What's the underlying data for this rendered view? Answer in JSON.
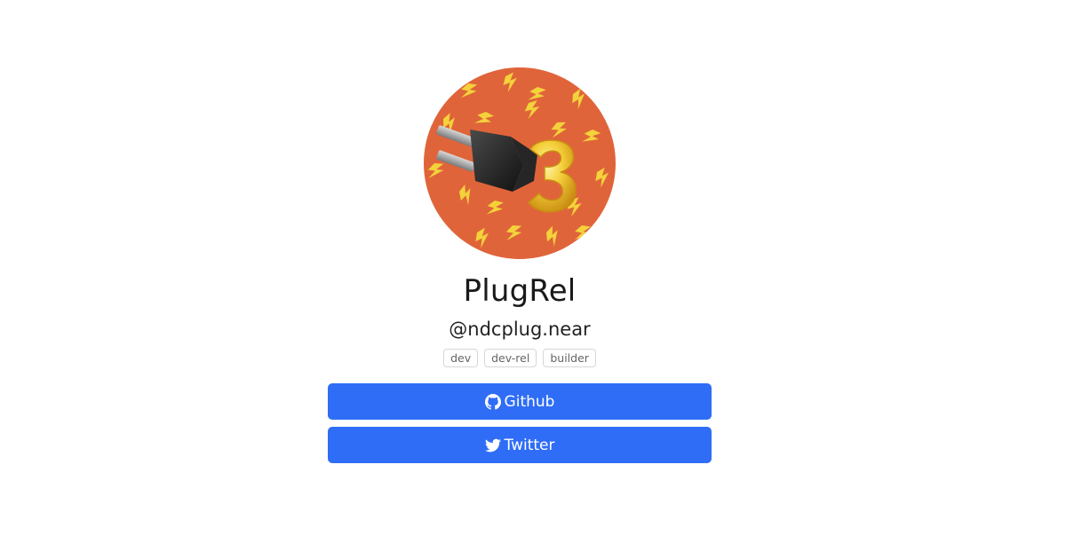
{
  "profile": {
    "name": "PlugRel",
    "handle": "@ndcplug.near",
    "avatar_icon": "plug-avatar-with-number-3",
    "tags": [
      "dev",
      "dev-rel",
      "builder"
    ]
  },
  "links": {
    "github": {
      "label": "Github",
      "icon": "github-icon"
    },
    "twitter": {
      "label": "Twitter",
      "icon": "twitter-icon"
    }
  },
  "colors": {
    "button_bg": "#2f6df6",
    "avatar_bg": "#e0643a",
    "bolt": "#f3d23a"
  }
}
